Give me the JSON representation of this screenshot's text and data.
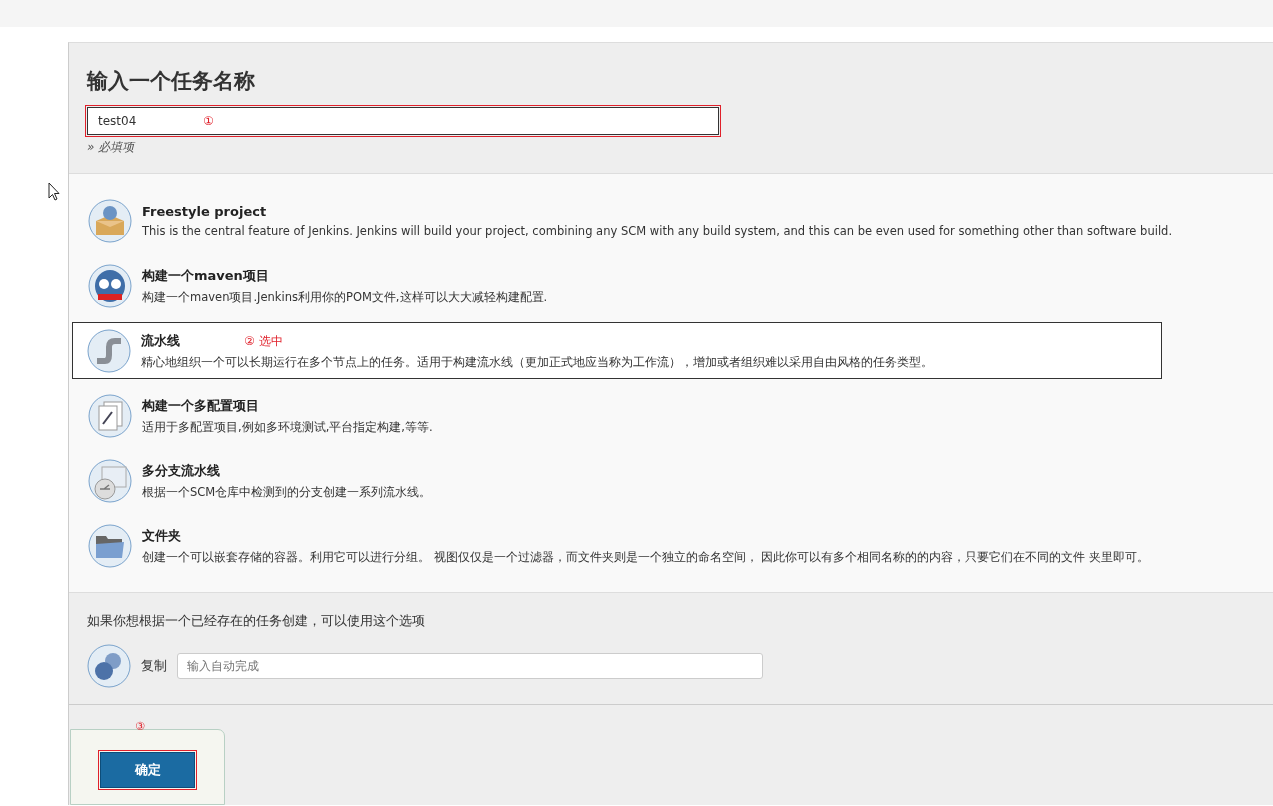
{
  "heading": "输入一个任务名称",
  "name_field": {
    "value": "test04",
    "annotation": "①"
  },
  "required_note": "» 必填项",
  "job_types": [
    {
      "kind": "freestyle",
      "title": "Freestyle project",
      "description": "This is the central feature of Jenkins. Jenkins will build your project, combining any SCM with any build system, and this can be even used for something other than software build.",
      "selected": false
    },
    {
      "kind": "maven",
      "title": "构建一个maven项目",
      "description": "构建一个maven项目.Jenkins利用你的POM文件,这样可以大大减轻构建配置.",
      "selected": false
    },
    {
      "kind": "pipeline",
      "title": "流水线",
      "annotation": "② 选中",
      "description": "精心地组织一个可以长期运行在多个节点上的任务。适用于构建流水线（更加正式地应当称为工作流），增加或者组织难以采用自由风格的任务类型。",
      "selected": true
    },
    {
      "kind": "matrix",
      "title": "构建一个多配置项目",
      "description": "适用于多配置项目,例如多环境测试,平台指定构建,等等.",
      "selected": false
    },
    {
      "kind": "multibranch",
      "title": "多分支流水线",
      "description": "根据一个SCM仓库中检测到的分支创建一系列流水线。",
      "selected": false
    },
    {
      "kind": "folder",
      "title": "文件夹",
      "description": "创建一个可以嵌套存储的容器。利用它可以进行分组。 视图仅仅是一个过滤器，而文件夹则是一个独立的命名空间， 因此你可以有多个相同名称的的内容，只要它们在不同的文件 夹里即可。",
      "selected": false
    }
  ],
  "copy": {
    "prompt": "如果你想根据一个已经存在的任务创建，可以使用这个选项",
    "label": "复制",
    "placeholder": "输入自动完成"
  },
  "ok_button": {
    "label": "确定",
    "annotation": "③"
  }
}
